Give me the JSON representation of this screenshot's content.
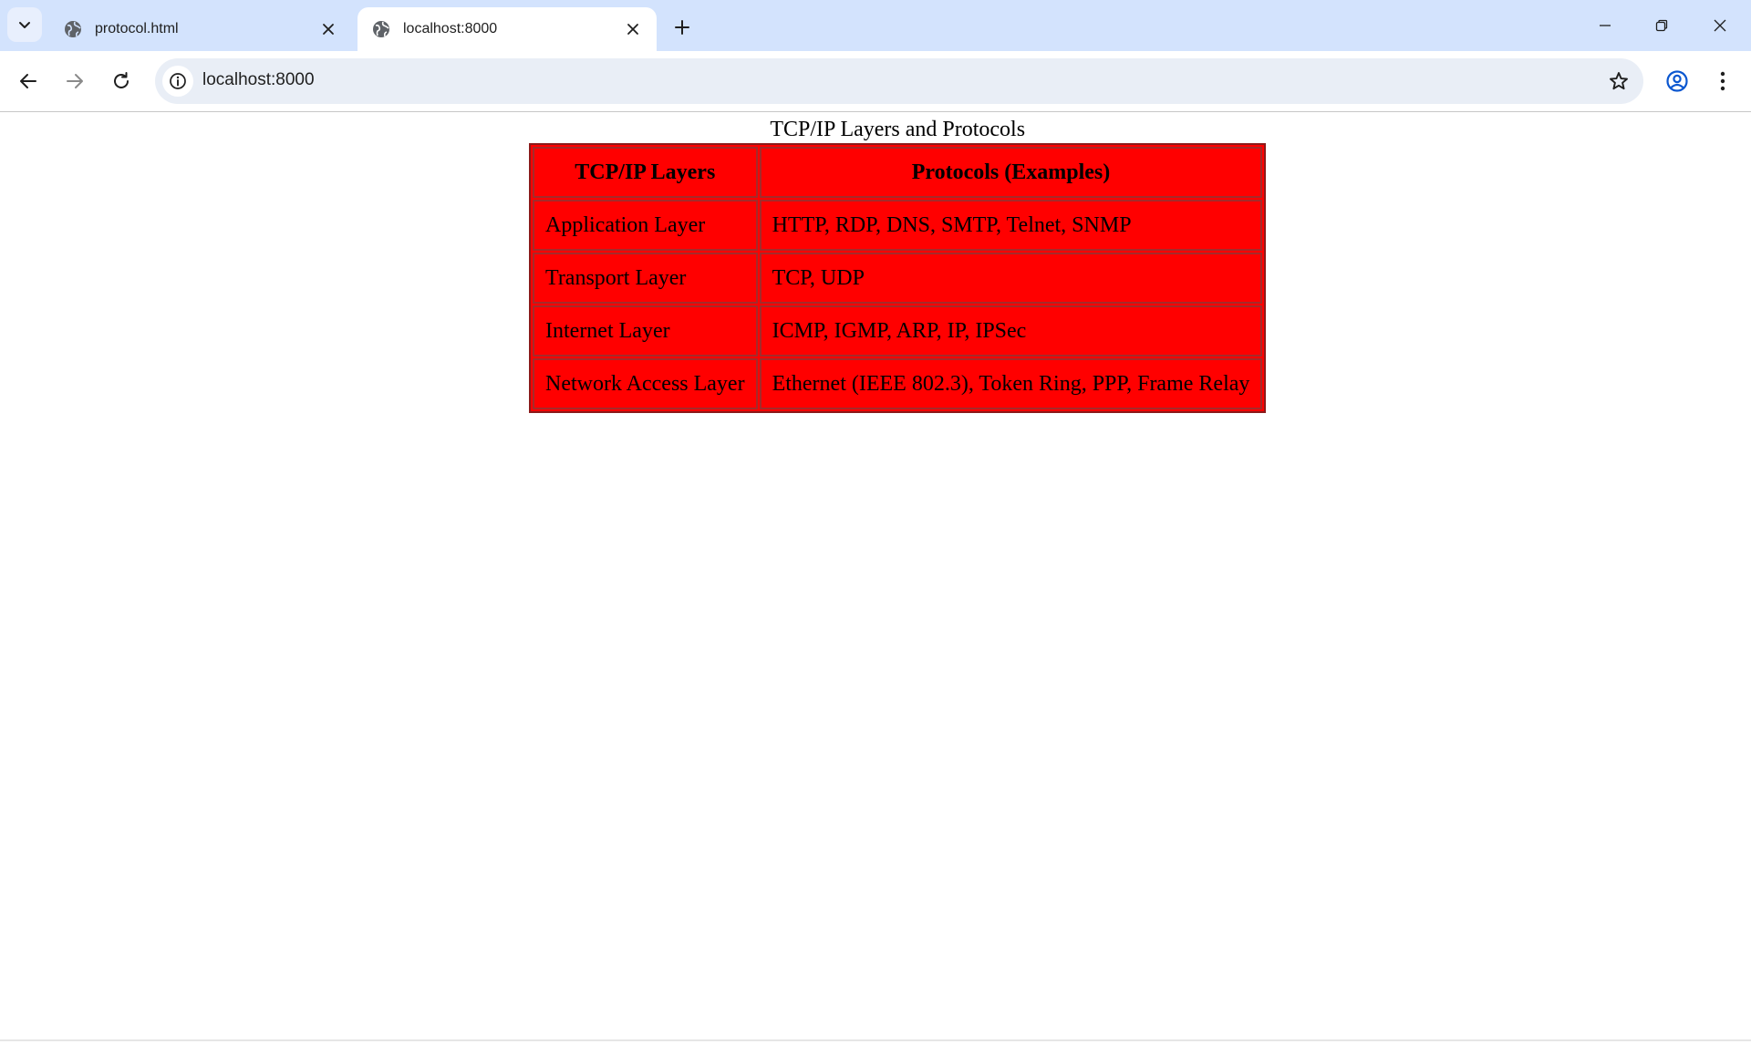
{
  "browser": {
    "tabs": [
      {
        "title": "protocol.html",
        "active": false
      },
      {
        "title": "localhost:8000",
        "active": true
      }
    ],
    "address_bar": {
      "url": "localhost:8000"
    },
    "icons": {
      "tab_search": "chevron-down-icon",
      "tab_favicon": "globe-icon",
      "tab_close": "close-icon",
      "new_tab": "plus-icon",
      "back": "arrow-left-icon",
      "forward": "arrow-right-icon",
      "reload": "reload-icon",
      "site_info": "info-icon",
      "bookmark": "star-icon",
      "profile": "profile-icon",
      "menu": "kebab-menu-icon",
      "minimize": "minimize-icon",
      "restore": "restore-icon",
      "close_window": "close-icon"
    },
    "colors": {
      "tab_strip": "#d3e3fd",
      "omnibox": "#e9eef6"
    }
  },
  "page": {
    "table": {
      "caption": "TCP/IP Layers and Protocols",
      "headers": [
        "TCP/IP Layers",
        "Protocols (Examples)"
      ],
      "rows": [
        [
          "Application Layer",
          "HTTP, RDP, DNS, SMTP, Telnet, SNMP"
        ],
        [
          "Transport Layer",
          "TCP, UDP"
        ],
        [
          "Internet Layer",
          "ICMP, IGMP, ARP, IP, IPSec"
        ],
        [
          "Network Access Layer",
          "Ethernet (IEEE 802.3), Token Ring, PPP, Frame Relay"
        ]
      ],
      "colors": {
        "cell_background": "#ff0000",
        "border": "#a52a2a"
      }
    }
  }
}
